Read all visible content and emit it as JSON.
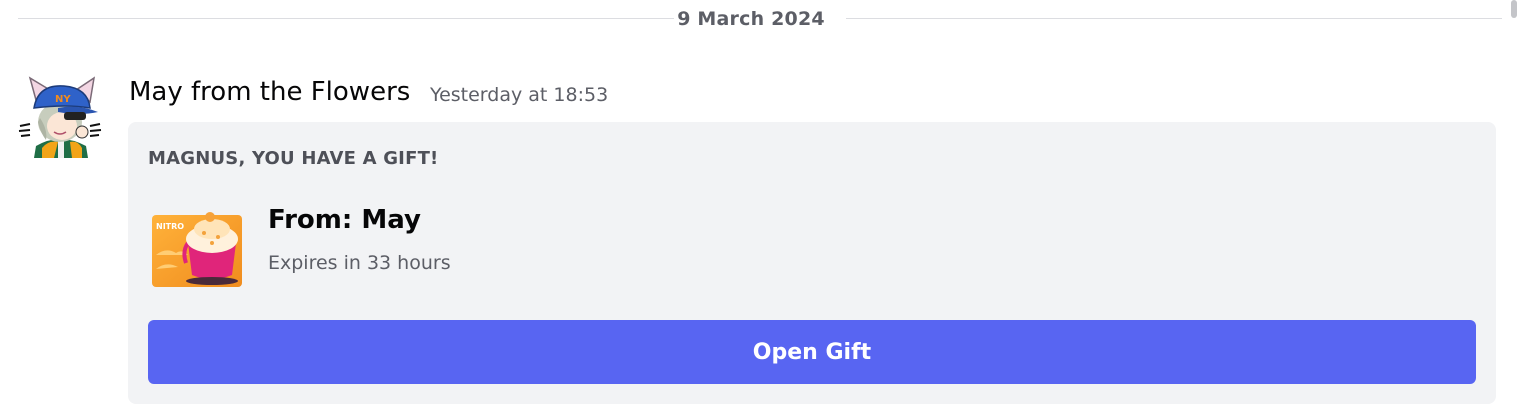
{
  "divider": {
    "date": "9 March 2024"
  },
  "message": {
    "author": "May from the Flowers",
    "timestamp": "Yesterday at 18:53",
    "avatar_icon": "cat-ear-cap-avatar"
  },
  "gift": {
    "heading": "MAGNUS, YOU HAVE A GIFT!",
    "thumbnail_label": "NITRO",
    "from_text": "From: May",
    "expiry_text": "Expires in 33 hours",
    "button_label": "Open Gift"
  },
  "colors": {
    "button_bg": "#5865f2",
    "card_bg": "#f2f3f5",
    "muted_text": "#5c5e66"
  }
}
